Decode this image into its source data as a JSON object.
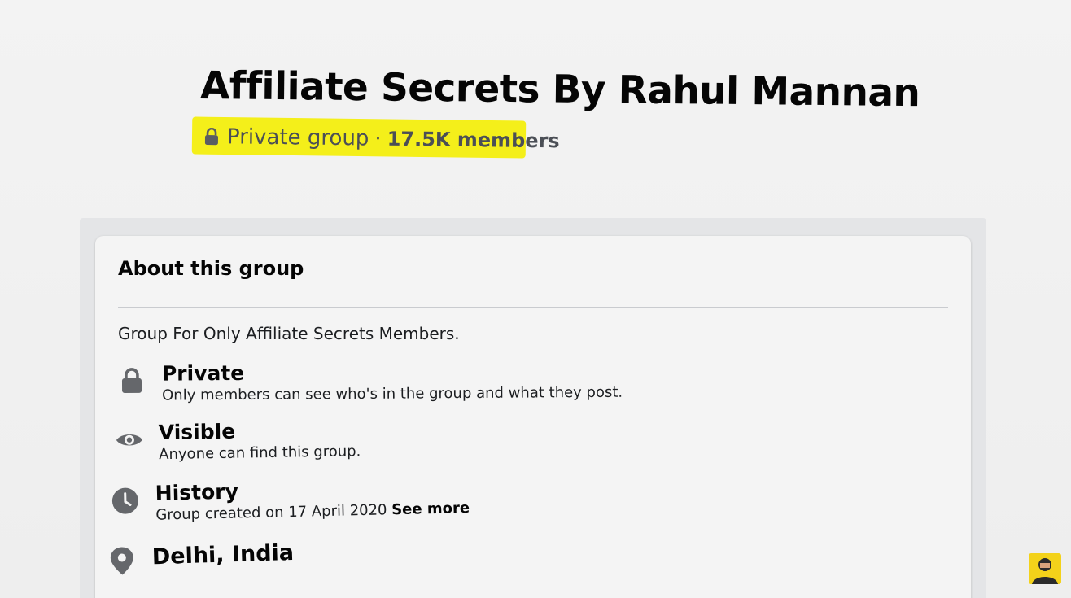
{
  "group": {
    "title": "Affiliate Secrets By Rahul Mannan",
    "privacy_label": "Private group",
    "separator": "·",
    "members": "17.5K members"
  },
  "about": {
    "heading": "About this group",
    "description": "Group For Only Affiliate Secrets Members.",
    "items": [
      {
        "icon": "lock-icon",
        "title": "Private",
        "subtitle": "Only members can see who's in the group and what they post."
      },
      {
        "icon": "eye-icon",
        "title": "Visible",
        "subtitle": "Anyone can find this group."
      },
      {
        "icon": "clock-icon",
        "title": "History",
        "subtitle": "Group created on 17 April 2020",
        "link": "See more"
      },
      {
        "icon": "location-pin-icon",
        "title": "Delhi, India"
      }
    ]
  },
  "colors": {
    "highlight": "#f4ef1a",
    "icon_gray": "#65676b",
    "avatar_bg": "#f3d21a"
  }
}
